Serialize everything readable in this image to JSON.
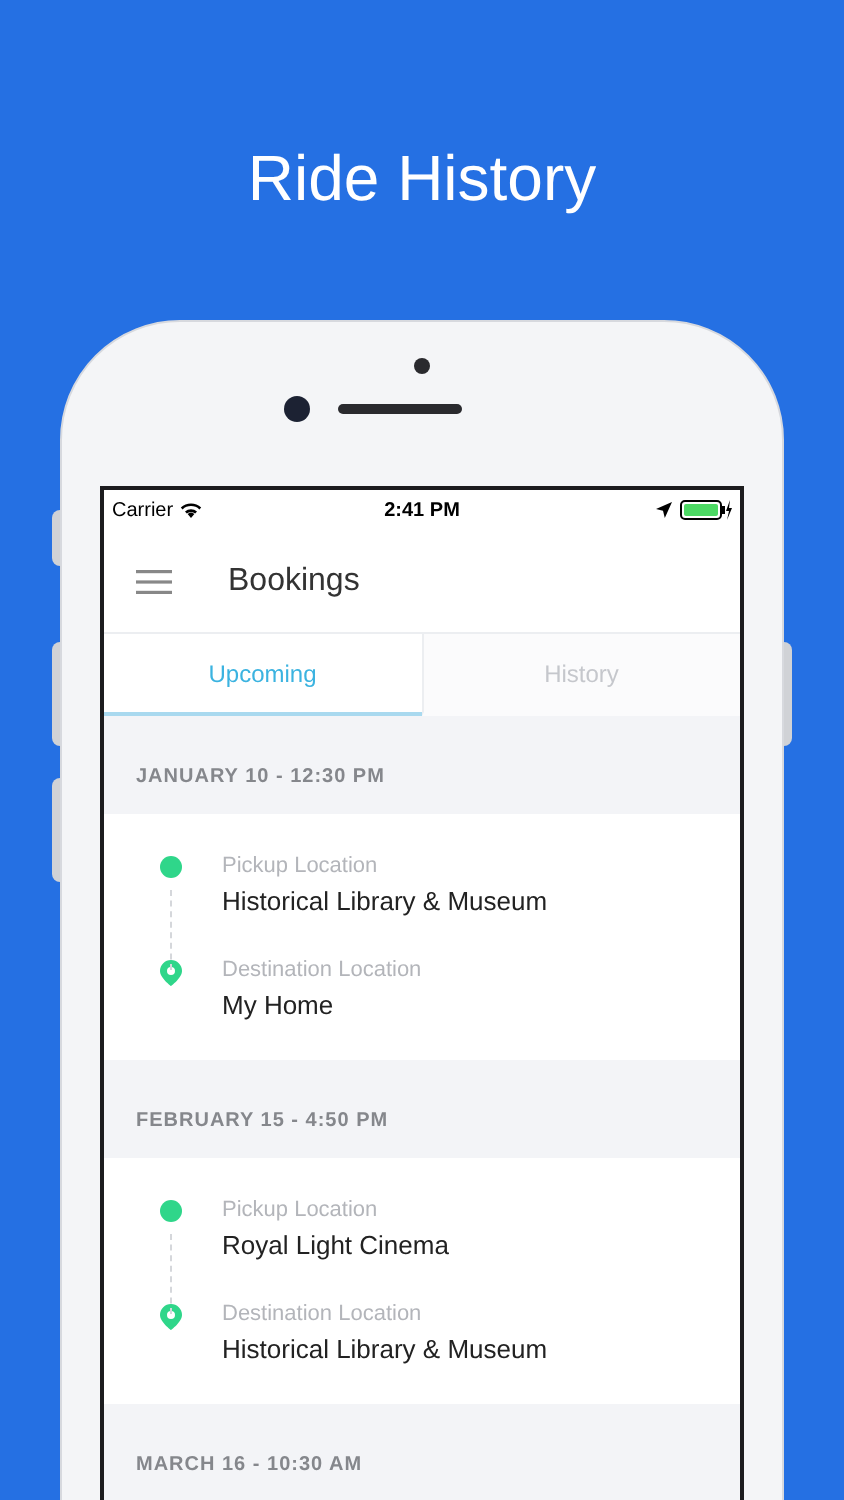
{
  "headline": "Ride History",
  "status_bar": {
    "carrier": "Carrier",
    "time": "2:41 PM"
  },
  "header": {
    "title": "Bookings"
  },
  "tabs": [
    {
      "label": "Upcoming",
      "selected": true
    },
    {
      "label": "History",
      "selected": false
    }
  ],
  "bookings": [
    {
      "date": "JANUARY 10 - 12:30 PM",
      "stops": [
        {
          "kind": "pickup",
          "label": "Pickup Location",
          "place": "Historical Library & Museum"
        },
        {
          "kind": "destination",
          "label": "Destination Location",
          "place": "My Home"
        }
      ]
    },
    {
      "date": "FEBRUARY 15 - 4:50 PM",
      "stops": [
        {
          "kind": "pickup",
          "label": "Pickup Location",
          "place": "Royal Light Cinema"
        },
        {
          "kind": "destination",
          "label": "Destination Location",
          "place": "Historical Library & Museum"
        }
      ]
    },
    {
      "date": "MARCH 16 - 10:30 AM"
    }
  ]
}
